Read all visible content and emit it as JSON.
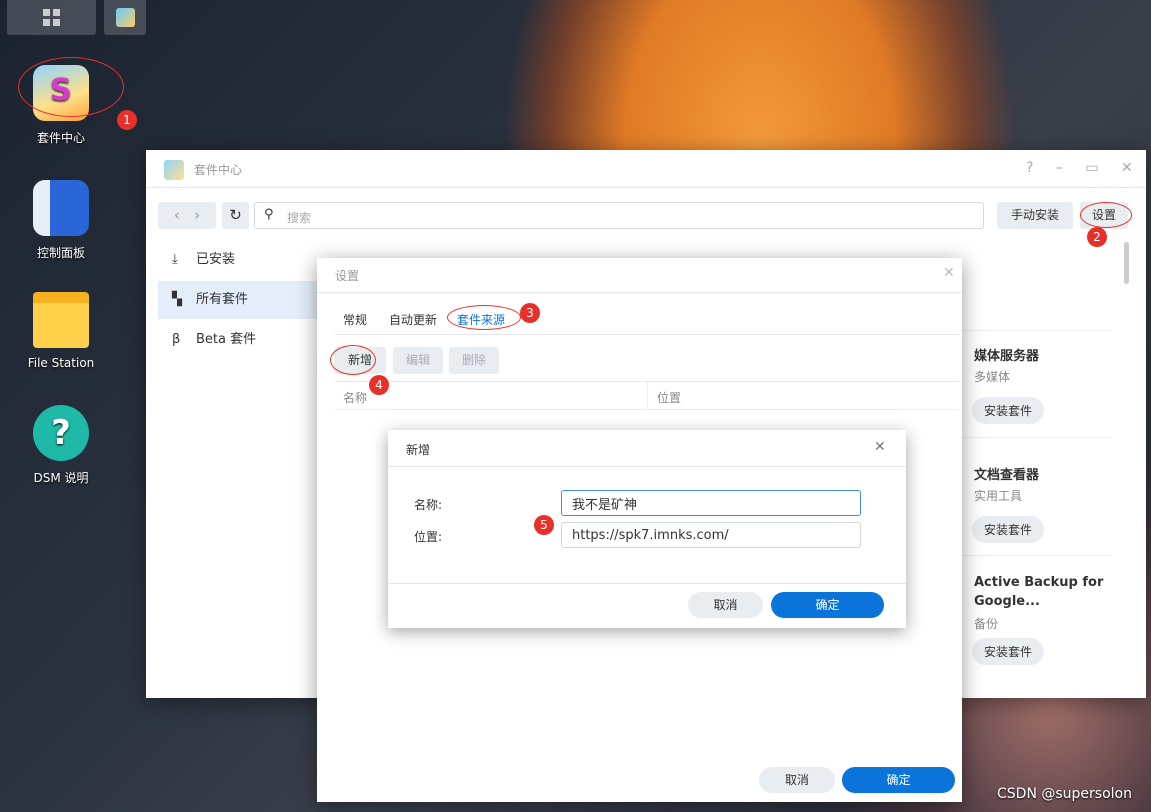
{
  "taskbar": {
    "icons": [
      "main-menu-icon",
      "package-center-icon"
    ]
  },
  "desktop": {
    "icons": [
      {
        "label": "套件中心",
        "icon": "package-center-icon"
      },
      {
        "label": "控制面板",
        "icon": "control-panel-icon"
      },
      {
        "label": "File Station",
        "icon": "folder-icon"
      },
      {
        "label": "DSM 说明",
        "icon": "help-icon"
      }
    ]
  },
  "window": {
    "title": "套件中心",
    "search_placeholder": "搜索",
    "manual_install": "手动安装",
    "settings": "设置",
    "sidebar": [
      {
        "label": "已安装",
        "icon": "download-icon"
      },
      {
        "label": "所有套件",
        "icon": "grid-icon"
      },
      {
        "label": "Beta 套件",
        "icon": "beta-icon"
      }
    ],
    "cards": [
      {
        "title": "媒体服务器",
        "sub": "多媒体",
        "btn": "安装套件"
      },
      {
        "title": "文档查看器",
        "sub": "实用工具",
        "btn": "安装套件"
      },
      {
        "title": "Active Backup for Google...",
        "sub": "备份",
        "btn": "安装套件"
      }
    ]
  },
  "settings": {
    "title": "设置",
    "tabs": [
      "常规",
      "自动更新",
      "套件来源"
    ],
    "active_tab": "套件来源",
    "actions": [
      "新增",
      "编辑",
      "删除"
    ],
    "columns": [
      "名称",
      "位置"
    ],
    "cancel": "取消",
    "ok": "确定"
  },
  "add_dialog": {
    "title": "新增",
    "name_label": "名称:",
    "name_value": "我不是矿神",
    "location_label": "位置:",
    "location_value": "https://spk7.imnks.com/",
    "cancel": "取消",
    "ok": "确定"
  },
  "annotations": [
    "1",
    "2",
    "3",
    "4",
    "5"
  ],
  "watermark": "CSDN @supersolon",
  "colors": {
    "accent": "#0a74da",
    "annotation": "#e8302a"
  }
}
